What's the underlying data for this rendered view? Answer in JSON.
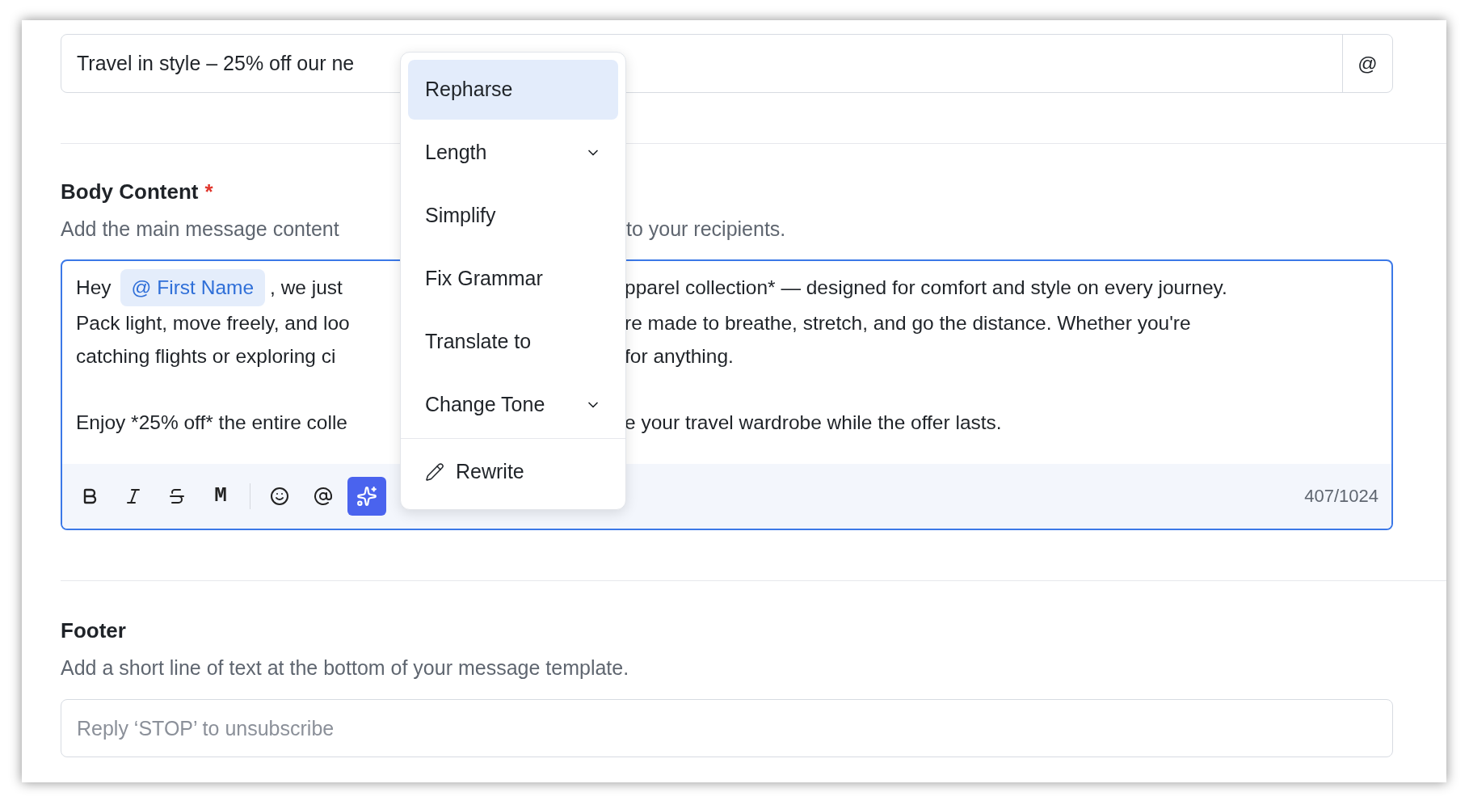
{
  "subject": {
    "value": "Travel in style – 25% off our ne",
    "mention_button": "@"
  },
  "body": {
    "label": "Body Content",
    "required_mark": "*",
    "description_left": "Add the main message content",
    "description_right": "to your recipients.",
    "lines": [
      {
        "left": "Hey",
        "chip": "@ First Name",
        "left_after": ", we just",
        "right": "pparel collection* — designed for comfort and style on every journey."
      },
      {
        "left": "Pack light, move freely, and loo",
        "right": "re made to breathe, stretch, and go the distance. Whether you're"
      },
      {
        "left": "catching flights or exploring ci",
        "right": "for anything."
      },
      {
        "kind": "blank"
      },
      {
        "left": "Enjoy *25% off* the entire colle",
        "right": "e your travel wardrobe while the offer lasts."
      }
    ],
    "toolbar": [
      {
        "kind": "bold",
        "selected": false
      },
      {
        "kind": "italic",
        "selected": false
      },
      {
        "kind": "strike",
        "selected": false
      },
      {
        "kind": "mono",
        "glyph": "M",
        "selected": false
      },
      {
        "kind": "divider"
      },
      {
        "kind": "emoji",
        "selected": false
      },
      {
        "kind": "mention",
        "selected": false
      },
      {
        "kind": "ai",
        "selected": true
      }
    ],
    "counter": "407/1024"
  },
  "menu": [
    {
      "kind": "item",
      "label": "Repharse",
      "selected": true,
      "has_submenu": false
    },
    {
      "kind": "item",
      "label": "Length",
      "selected": false,
      "has_submenu": true
    },
    {
      "kind": "item",
      "label": "Simplify",
      "selected": false,
      "has_submenu": false
    },
    {
      "kind": "item",
      "label": "Fix Grammar",
      "selected": false,
      "has_submenu": false
    },
    {
      "kind": "item",
      "label": "Translate to",
      "selected": false,
      "has_submenu": false
    },
    {
      "kind": "item",
      "label": "Change Tone",
      "selected": false,
      "has_submenu": true
    },
    {
      "kind": "action",
      "label": "Rewrite",
      "selected": false
    }
  ],
  "footer": {
    "label": "Footer",
    "description": "Add a short line of text at the bottom of your message template.",
    "placeholder": "Reply ‘STOP’ to unsubscribe"
  }
}
